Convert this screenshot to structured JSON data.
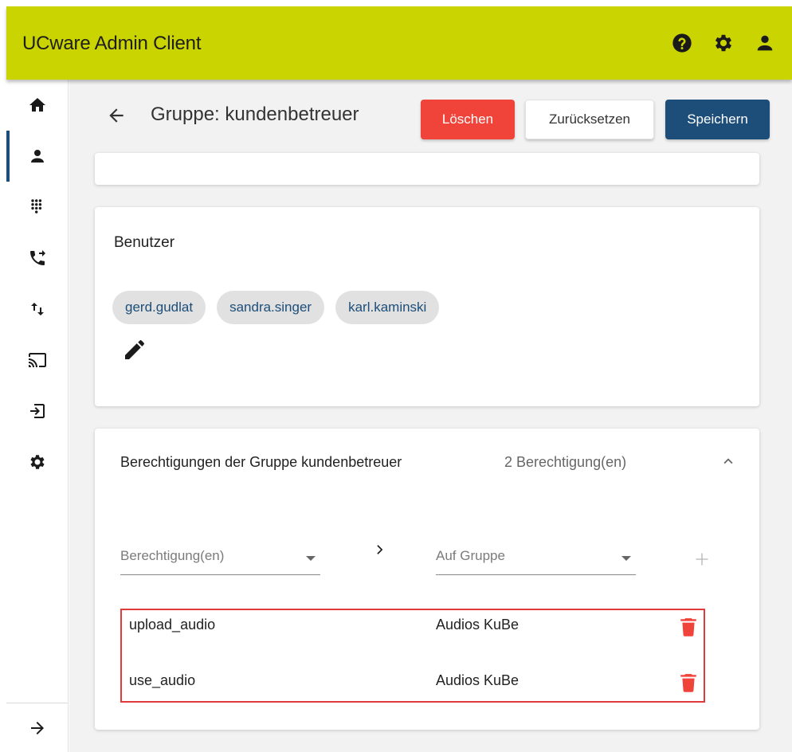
{
  "app": {
    "title": "UCware Admin Client"
  },
  "topbar": {
    "icons": [
      "help-icon",
      "settings-icon",
      "account-icon"
    ]
  },
  "sidebar": {
    "items": [
      {
        "icon": "home-icon",
        "active": false
      },
      {
        "icon": "user-icon",
        "active": true
      },
      {
        "icon": "dialpad-icon",
        "active": false
      },
      {
        "icon": "phone-forward-icon",
        "active": false
      },
      {
        "icon": "swap-vertical-icon",
        "active": false
      },
      {
        "icon": "cast-icon",
        "active": false
      },
      {
        "icon": "login-icon",
        "active": false
      },
      {
        "icon": "gear-icon",
        "active": false
      }
    ],
    "expand_icon": "arrow-right-icon"
  },
  "header": {
    "title": "Gruppe: kundenbetreuer",
    "delete_label": "Löschen",
    "reset_label": "Zurücksetzen",
    "save_label": "Speichern"
  },
  "users": {
    "title": "Benutzer",
    "chips": [
      "gerd.gudlat",
      "sandra.singer",
      "karl.kaminski"
    ]
  },
  "permissions": {
    "title": "Berechtigungen der Gruppe kundenbetreuer",
    "count": "2 Berechtigung(en)",
    "permission_placeholder": "Berechtigung(en)",
    "group_placeholder": "Auf Gruppe",
    "rows": [
      {
        "name": "upload_audio",
        "group": "Audios KuBe"
      },
      {
        "name": "use_audio",
        "group": "Audios KuBe"
      }
    ]
  },
  "colors": {
    "topbar": "#c9d400",
    "primary": "#1d4e79",
    "danger": "#f0433a",
    "highlight_border": "#e03a3a"
  }
}
